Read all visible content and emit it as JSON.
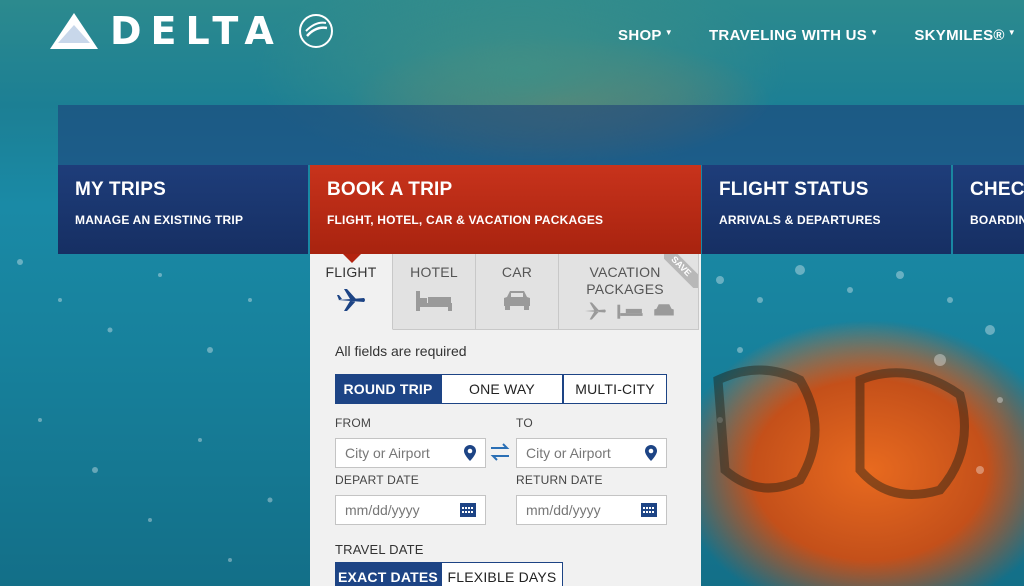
{
  "brand": {
    "name": "DELTA"
  },
  "topnav": [
    {
      "label": "SHOP"
    },
    {
      "label": "TRAVELING WITH US"
    },
    {
      "label": "SKYMILES®"
    }
  ],
  "tiles": [
    {
      "title": "MY TRIPS",
      "sub": "MANAGE AN EXISTING TRIP"
    },
    {
      "title": "BOOK A TRIP",
      "sub": "FLIGHT, HOTEL, CAR & VACATION PACKAGES"
    },
    {
      "title": "FLIGHT STATUS",
      "sub": "ARRIVALS & DEPARTURES"
    },
    {
      "title": "CHECK",
      "sub": "BOARDIN"
    }
  ],
  "booking": {
    "tabs": [
      {
        "label": "FLIGHT"
      },
      {
        "label": "HOTEL"
      },
      {
        "label": "CAR"
      },
      {
        "label": "VACATION PACKAGES"
      }
    ],
    "save_badge": "SAVE",
    "required_note": "All fields are required",
    "trip_types": [
      "ROUND TRIP",
      "ONE WAY",
      "MULTI-CITY"
    ],
    "from_label": "FROM",
    "to_label": "TO",
    "from_placeholder": "City or Airport",
    "to_placeholder": "City or Airport",
    "depart_label": "DEPART DATE",
    "return_label": "RETURN DATE",
    "depart_placeholder": "mm/dd/yyyy",
    "return_placeholder": "mm/dd/yyyy",
    "travel_date_label": "TRAVEL DATE",
    "date_modes": [
      "EXACT DATES",
      "FLEXIBLE DAYS"
    ]
  },
  "colors": {
    "navy": "#162f63",
    "red": "#b3230f",
    "accent_blue": "#1d4485"
  }
}
